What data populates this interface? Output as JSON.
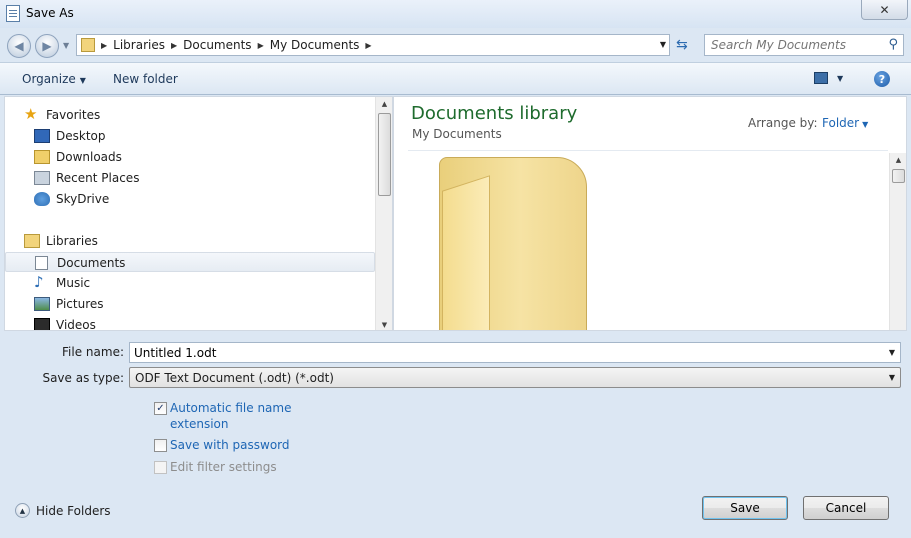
{
  "window": {
    "title": "Save As",
    "close_symbol": "✕"
  },
  "address": {
    "crumbs": [
      "Libraries",
      "Documents",
      "My Documents"
    ]
  },
  "search": {
    "placeholder": "Search My Documents"
  },
  "toolbar": {
    "organize_label": "Organize",
    "new_folder_label": "New folder",
    "help_symbol": "?"
  },
  "nav": {
    "favorites_label": "Favorites",
    "favorites": [
      "Desktop",
      "Downloads",
      "Recent Places",
      "SkyDrive"
    ],
    "libraries_label": "Libraries",
    "libraries": [
      "Documents",
      "Music",
      "Pictures",
      "Videos"
    ],
    "selected": "Documents"
  },
  "content": {
    "title": "Documents library",
    "subtitle": "My Documents",
    "arrange_label": "Arrange by:",
    "arrange_value": "Folder"
  },
  "form": {
    "filename_label": "File name:",
    "filename_value": "Untitled 1.odt",
    "type_label": "Save as type:",
    "type_value": "ODF Text Document (.odt) (*.odt)"
  },
  "options": {
    "auto_ext_line1": "Automatic file name",
    "auto_ext_line2": "extension",
    "auto_ext_checked": true,
    "password_label": "Save with password",
    "password_checked": false,
    "filter_label": "Edit filter settings",
    "filter_checked": false
  },
  "footer": {
    "hide_folders_label": "Hide Folders",
    "save_label": "Save",
    "cancel_label": "Cancel"
  },
  "colors": {
    "library_title": "#1e6b2d",
    "link_blue": "#1e66b4",
    "toolbar_text": "#1e395b"
  }
}
